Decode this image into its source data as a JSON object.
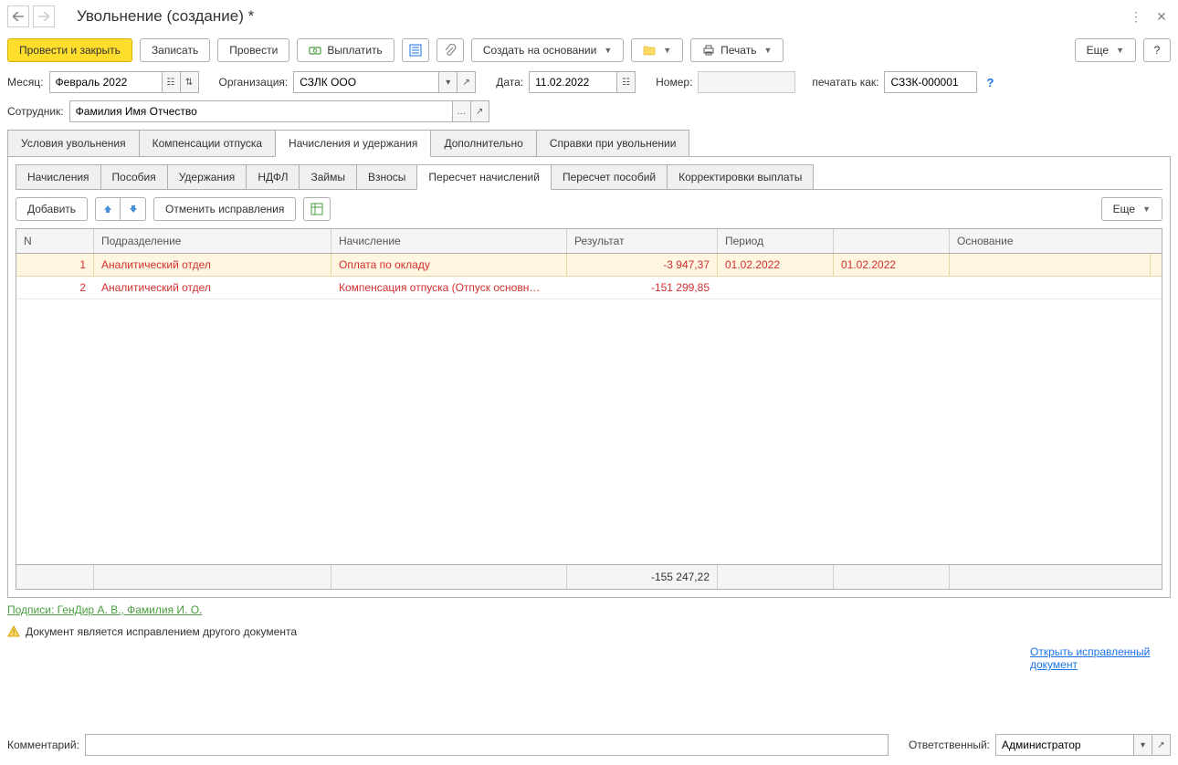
{
  "title": "Увольнение (создание) *",
  "toolbar": {
    "post_close": "Провести и закрыть",
    "write": "Записать",
    "post": "Провести",
    "pay": "Выплатить",
    "create_based": "Создать на основании",
    "print": "Печать",
    "more": "Еще",
    "help": "?"
  },
  "fields": {
    "month_label": "Месяц:",
    "month_value": "Февраль 2022",
    "org_label": "Организация:",
    "org_value": "СЗЛК ООО",
    "date_label": "Дата:",
    "date_value": "11.02.2022",
    "number_label": "Номер:",
    "number_value": "",
    "print_as_label": "печатать как:",
    "print_as_value": "СЗЗК-000001",
    "employee_label": "Сотрудник:",
    "employee_value": "Фамилия Имя Отчество"
  },
  "main_tabs": [
    "Условия увольнения",
    "Компенсации отпуска",
    "Начисления и удержания",
    "Дополнительно",
    "Справки при увольнении"
  ],
  "main_tab_active": 2,
  "sub_tabs": [
    "Начисления",
    "Пособия",
    "Удержания",
    "НДФЛ",
    "Займы",
    "Взносы",
    "Пересчет начислений",
    "Пересчет пособий",
    "Корректировки выплаты"
  ],
  "sub_tab_active": 6,
  "subtoolbar": {
    "add": "Добавить",
    "cancel_fix": "Отменить исправления",
    "more": "Еще"
  },
  "grid": {
    "headers": {
      "n": "N",
      "department": "Подразделение",
      "accrual": "Начисление",
      "result": "Результат",
      "period": "Период",
      "basis": "Основание"
    },
    "rows": [
      {
        "n": "1",
        "department": "Аналитический отдел",
        "accrual": "Оплата по окладу",
        "result": "-3 947,37",
        "period1": "01.02.2022",
        "period2": "01.02.2022",
        "basis": ""
      },
      {
        "n": "2",
        "department": "Аналитический отдел",
        "accrual": "Компенсация отпуска (Отпуск основн…",
        "result": "-151 299,85",
        "period1": "",
        "period2": "",
        "basis": ""
      }
    ],
    "total_result": "-155 247,22"
  },
  "signatures": "Подписи: ГенДир А. В., Фамилия И. О.",
  "warning": "Документ является исправлением другого документа",
  "open_corrected": "Открыть исправленный документ",
  "bottom": {
    "comment_label": "Комментарий:",
    "comment_value": "",
    "responsible_label": "Ответственный:",
    "responsible_value": "Администратор"
  }
}
